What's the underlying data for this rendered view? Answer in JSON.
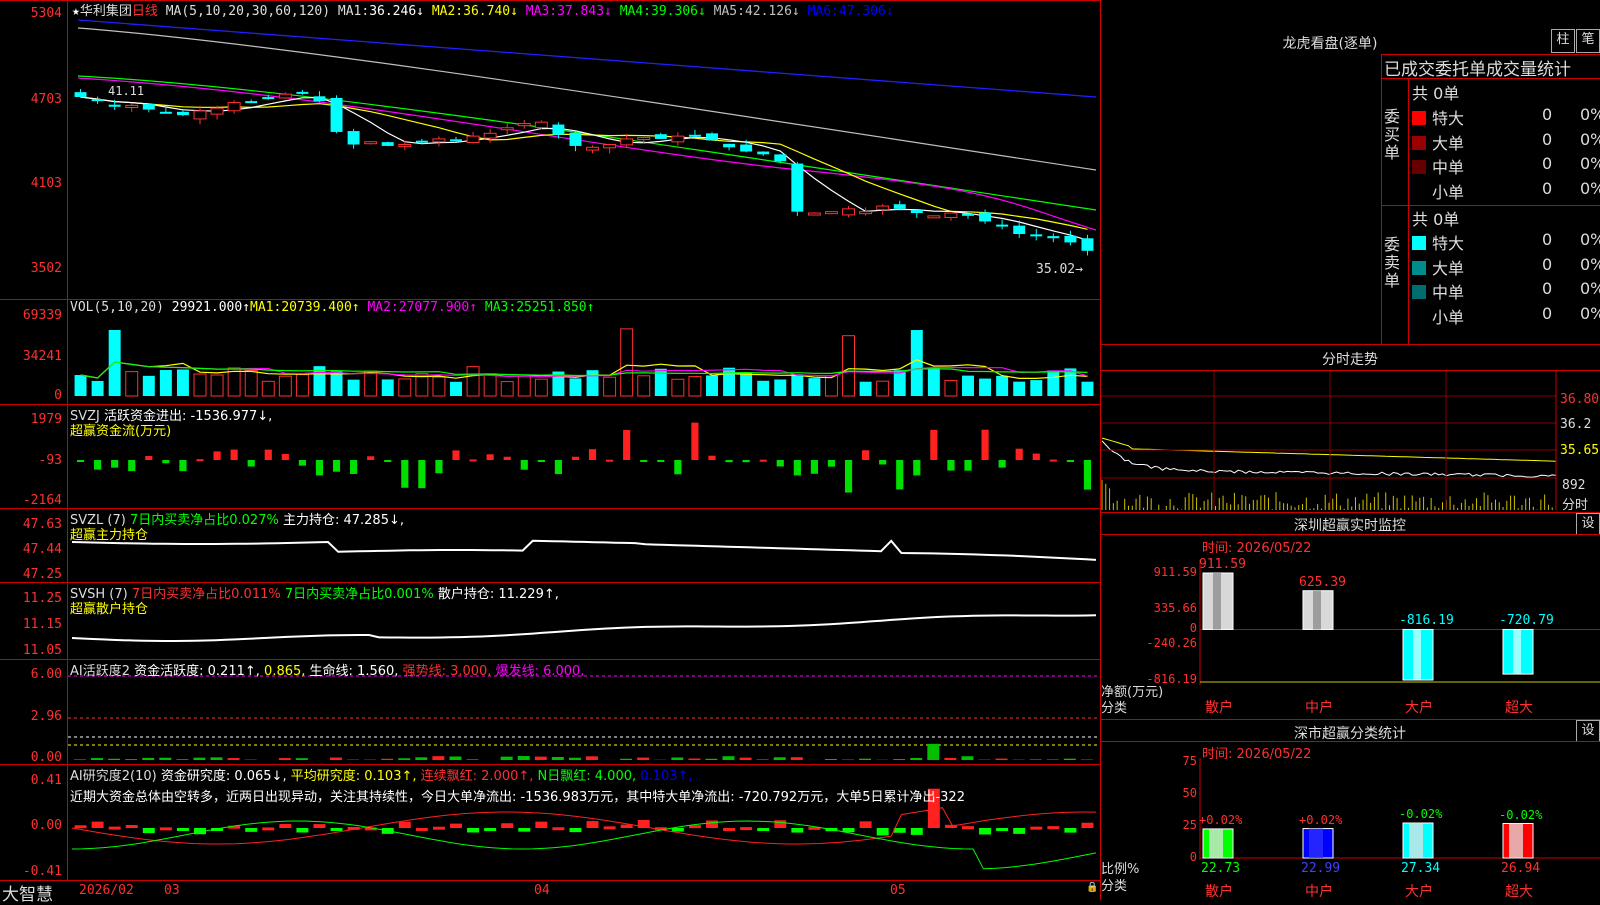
{
  "stock": {
    "star": "★",
    "name": "华利集团",
    "period": "日线",
    "ma_title": "MA(5,10,20,30,60,120)",
    "ma": [
      {
        "label": "MA1:",
        "value": "36.246↓",
        "color": "#ffffff"
      },
      {
        "label": "MA2:",
        "value": "36.740↓",
        "color": "#ffff00"
      },
      {
        "label": "MA3:",
        "value": "37.843↓",
        "color": "#ff00ff"
      },
      {
        "label": "MA4:",
        "value": "39.306↓",
        "color": "#00ff00"
      },
      {
        "label": "MA5:",
        "value": "42.126↓",
        "color": "#c0c0c0"
      },
      {
        "label": "MA6:",
        "value": "47.306↓",
        "color": "#0000ff"
      }
    ],
    "price_axis": [
      "5304",
      "4703",
      "4103",
      "3502"
    ],
    "last_price_mark": "35.02",
    "low_mark": "41.11"
  },
  "vol": {
    "title": "VOL(5,10,20)",
    "value": "29921.000↑",
    "ma": [
      {
        "label": "MA1:",
        "value": "20739.400↑",
        "color": "#ffff00"
      },
      {
        "label": "MA2:",
        "value": "27077.900↑",
        "color": "#ff00ff"
      },
      {
        "label": "MA3:",
        "value": "25251.850↑",
        "color": "#00ff00"
      }
    ],
    "axis": [
      "69339",
      "34241",
      "0"
    ]
  },
  "svzj": {
    "title": "SVZJ",
    "desc": "活跃资金进出: -1536.977↓,",
    "subtitle": "超赢资金流(万元)",
    "axis": [
      "1979",
      "-93",
      "-2164"
    ]
  },
  "svzl": {
    "title": "SVZL (7)",
    "desc1": "7日内买卖净占比0.027%",
    "desc2": "主力持仓: 47.285↓,",
    "subtitle": "超赢主力持仓",
    "axis": [
      "47.63",
      "47.44",
      "47.25"
    ]
  },
  "svsh": {
    "title": "SVSH (7)",
    "desc1": "7日内买卖净占比0.011%",
    "desc2": "7日内买卖净占比0.001%",
    "desc3": "散户持仓: 11.229↑,",
    "subtitle": "超赢散户持仓",
    "axis": [
      "11.25",
      "11.15",
      "11.05"
    ]
  },
  "ai1": {
    "title": "AI活跃度2",
    "desc1": "资金活跃度: 0.211↑,",
    "desc2": "0.865,",
    "desc3": "生命线: 1.560,",
    "desc4": "强势线: 3.000,",
    "desc5": "爆发线: 6.000,",
    "axis": [
      "6.00",
      "2.96",
      "0.00"
    ]
  },
  "ai2": {
    "title": "AI研究度2(10)",
    "desc1": "资金研究度: 0.065↓,",
    "desc2": "平均研究度: 0.103↑,",
    "desc3": "连续飘红: 2.000↑,",
    "desc4": "N日飘红: 4.000,",
    "desc5": "0.103↑,",
    "comment": "近期大资金总体由空转多，近两日出现异动，关注其持续性，今日大单净流出: -1536.983万元，其中特大单净流出: -720.792万元，大单5日累计净出-322",
    "axis": [
      "0.41",
      "0.00",
      "-0.41"
    ]
  },
  "bottom": {
    "brand": "大智慧",
    "dates": [
      "2026/02",
      "03",
      "04",
      "05"
    ]
  },
  "right": {
    "dragon_title": "龙虎看盘(逐单)",
    "btn_bar": "柱",
    "btn_pen": "笔",
    "order_header": "已成交委托单成交量统计",
    "buy_label": "委买单",
    "sell_label": "委卖单",
    "buy_total": "共 0单",
    "sell_total": "共 0单",
    "buy_rows": [
      {
        "name": "特大",
        "count": "0",
        "pct": "0%",
        "color": "#ff0000"
      },
      {
        "name": "大单",
        "count": "0",
        "pct": "0%",
        "color": "#990000"
      },
      {
        "name": "中单",
        "count": "0",
        "pct": "0%",
        "color": "#660000"
      },
      {
        "name": "小单",
        "count": "0",
        "pct": "0%",
        "color": ""
      }
    ],
    "sell_rows": [
      {
        "name": "特大",
        "count": "0",
        "pct": "0%",
        "color": "#00ffff"
      },
      {
        "name": "大单",
        "count": "0",
        "pct": "0%",
        "color": "#008c8c"
      },
      {
        "name": "中单",
        "count": "0",
        "pct": "0%",
        "color": "#006e6e"
      },
      {
        "name": "小单",
        "count": "0",
        "pct": "0%",
        "color": ""
      }
    ],
    "intraday_title": "分时走势",
    "intraday_axis": [
      "36.80",
      "36.2",
      "35.65",
      "892"
    ],
    "intraday_unit": "分时",
    "monitor_title": "深圳超赢实时监控",
    "btn_set": "设",
    "monitor_time": "时间: 2026/05/22",
    "monitor_axis": [
      "911.59",
      "335.66",
      "0",
      "-240.26",
      "-816.19"
    ],
    "monitor_ylabel": "净额(万元)",
    "monitor_xlabel": "分类",
    "categories": [
      "散户",
      "中户",
      "大户",
      "超大"
    ],
    "stats_title": "深市超赢分类统计",
    "stats_time": "时间: 2026/05/22",
    "stats_axis": [
      "75",
      "50",
      "25",
      "0"
    ],
    "stats_ylabel": "比例%",
    "stats_xlabel": "分类"
  },
  "chart_data": [
    {
      "type": "bar",
      "title": "深圳超赢实时监控",
      "categories": [
        "散户",
        "中户",
        "大户",
        "超大"
      ],
      "values": [
        911.59,
        625.39,
        -816.19,
        -720.79
      ],
      "value_labels": [
        "911.59",
        "625.39",
        "-816.19",
        "-720.79"
      ],
      "ylabel": "净额(万元)",
      "xlabel": "分类",
      "ylim": [
        -816.19,
        911.59
      ],
      "colors": [
        "#d8d8d8",
        "#d8d8d8",
        "#00ffff",
        "#00ffff"
      ]
    },
    {
      "type": "bar",
      "title": "深市超赢分类统计",
      "categories": [
        "散户",
        "中户",
        "大户",
        "超大"
      ],
      "values": [
        22.73,
        22.99,
        27.34,
        26.94
      ],
      "value_labels": [
        "22.73",
        "22.99",
        "27.34",
        "26.94"
      ],
      "change_labels": [
        "+0.02%",
        "+0.02%",
        "-0.02%",
        "-0.02%"
      ],
      "ylabel": "比例%",
      "xlabel": "分类",
      "ylim": [
        0,
        75
      ],
      "colors": [
        "#00ff00",
        "#0000ff",
        "#00ffff",
        "#ff0000"
      ]
    }
  ]
}
